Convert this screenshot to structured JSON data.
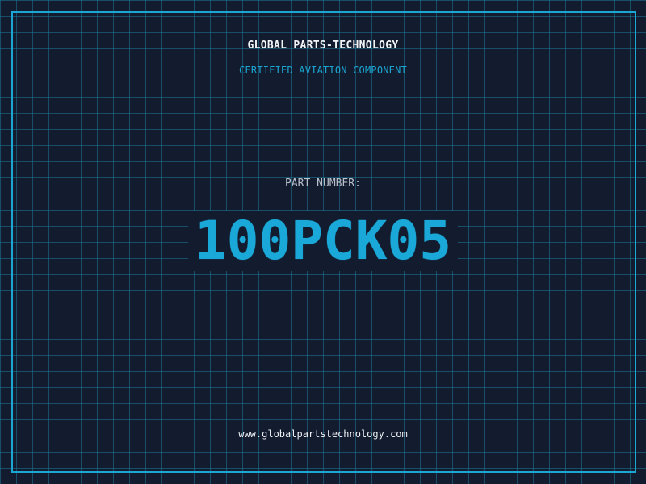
{
  "header": {
    "company": "GLOBAL PARTS-TECHNOLOGY",
    "subtitle": "CERTIFIED AVIATION COMPONENT"
  },
  "part": {
    "label": "PART NUMBER:",
    "number": "100PCK05"
  },
  "footer": {
    "website": "www.globalpartstechnology.com"
  },
  "colors": {
    "background": "#131b2e",
    "grid": "#1c7896",
    "accent": "#1ba7d3",
    "text": "#f2f5f8"
  }
}
